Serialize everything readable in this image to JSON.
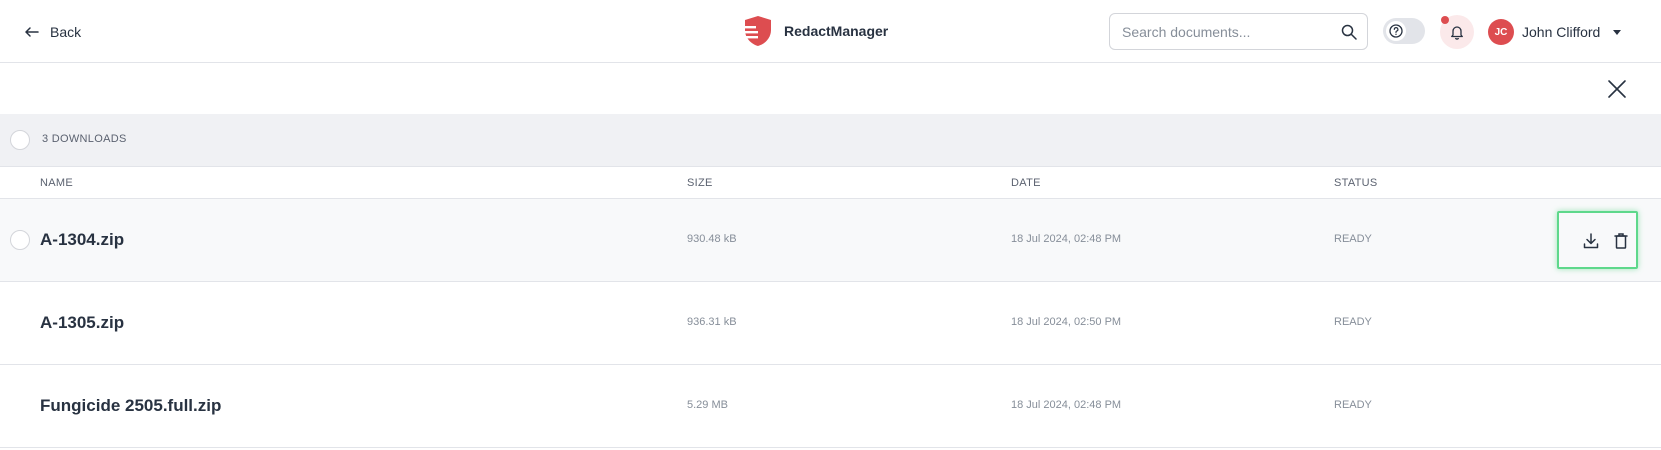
{
  "header": {
    "back_label": "Back",
    "app_name": "RedactManager",
    "search_placeholder": "Search documents...",
    "user": {
      "initials": "JC",
      "name": "John Clifford"
    },
    "notification_dot": true
  },
  "colors": {
    "brand_red": "#dd4d50",
    "highlight_green": "#5ed88b",
    "text_primary": "#283241",
    "text_muted": "#868e99"
  },
  "downloads": {
    "count_label": "3 DOWNLOADS",
    "columns": {
      "name": "NAME",
      "size": "SIZE",
      "date": "DATE",
      "status": "STATUS"
    },
    "rows": [
      {
        "name": "A-1304.zip",
        "size": "930.48 kB",
        "date": "18 Jul 2024, 02:48 PM",
        "status": "READY"
      },
      {
        "name": "A-1305.zip",
        "size": "936.31 kB",
        "date": "18 Jul 2024, 02:50 PM",
        "status": "READY"
      },
      {
        "name": "Fungicide 2505.full.zip",
        "size": "5.29 MB",
        "date": "18 Jul 2024, 02:48 PM",
        "status": "READY"
      }
    ]
  },
  "icons": {
    "back": "arrow-left-icon",
    "logo": "shield-logo-icon",
    "search": "search-icon",
    "help": "help-icon",
    "notifications": "bell-icon",
    "user_menu": "chevron-down-icon",
    "close": "close-icon",
    "download": "download-icon",
    "delete": "trash-icon"
  }
}
